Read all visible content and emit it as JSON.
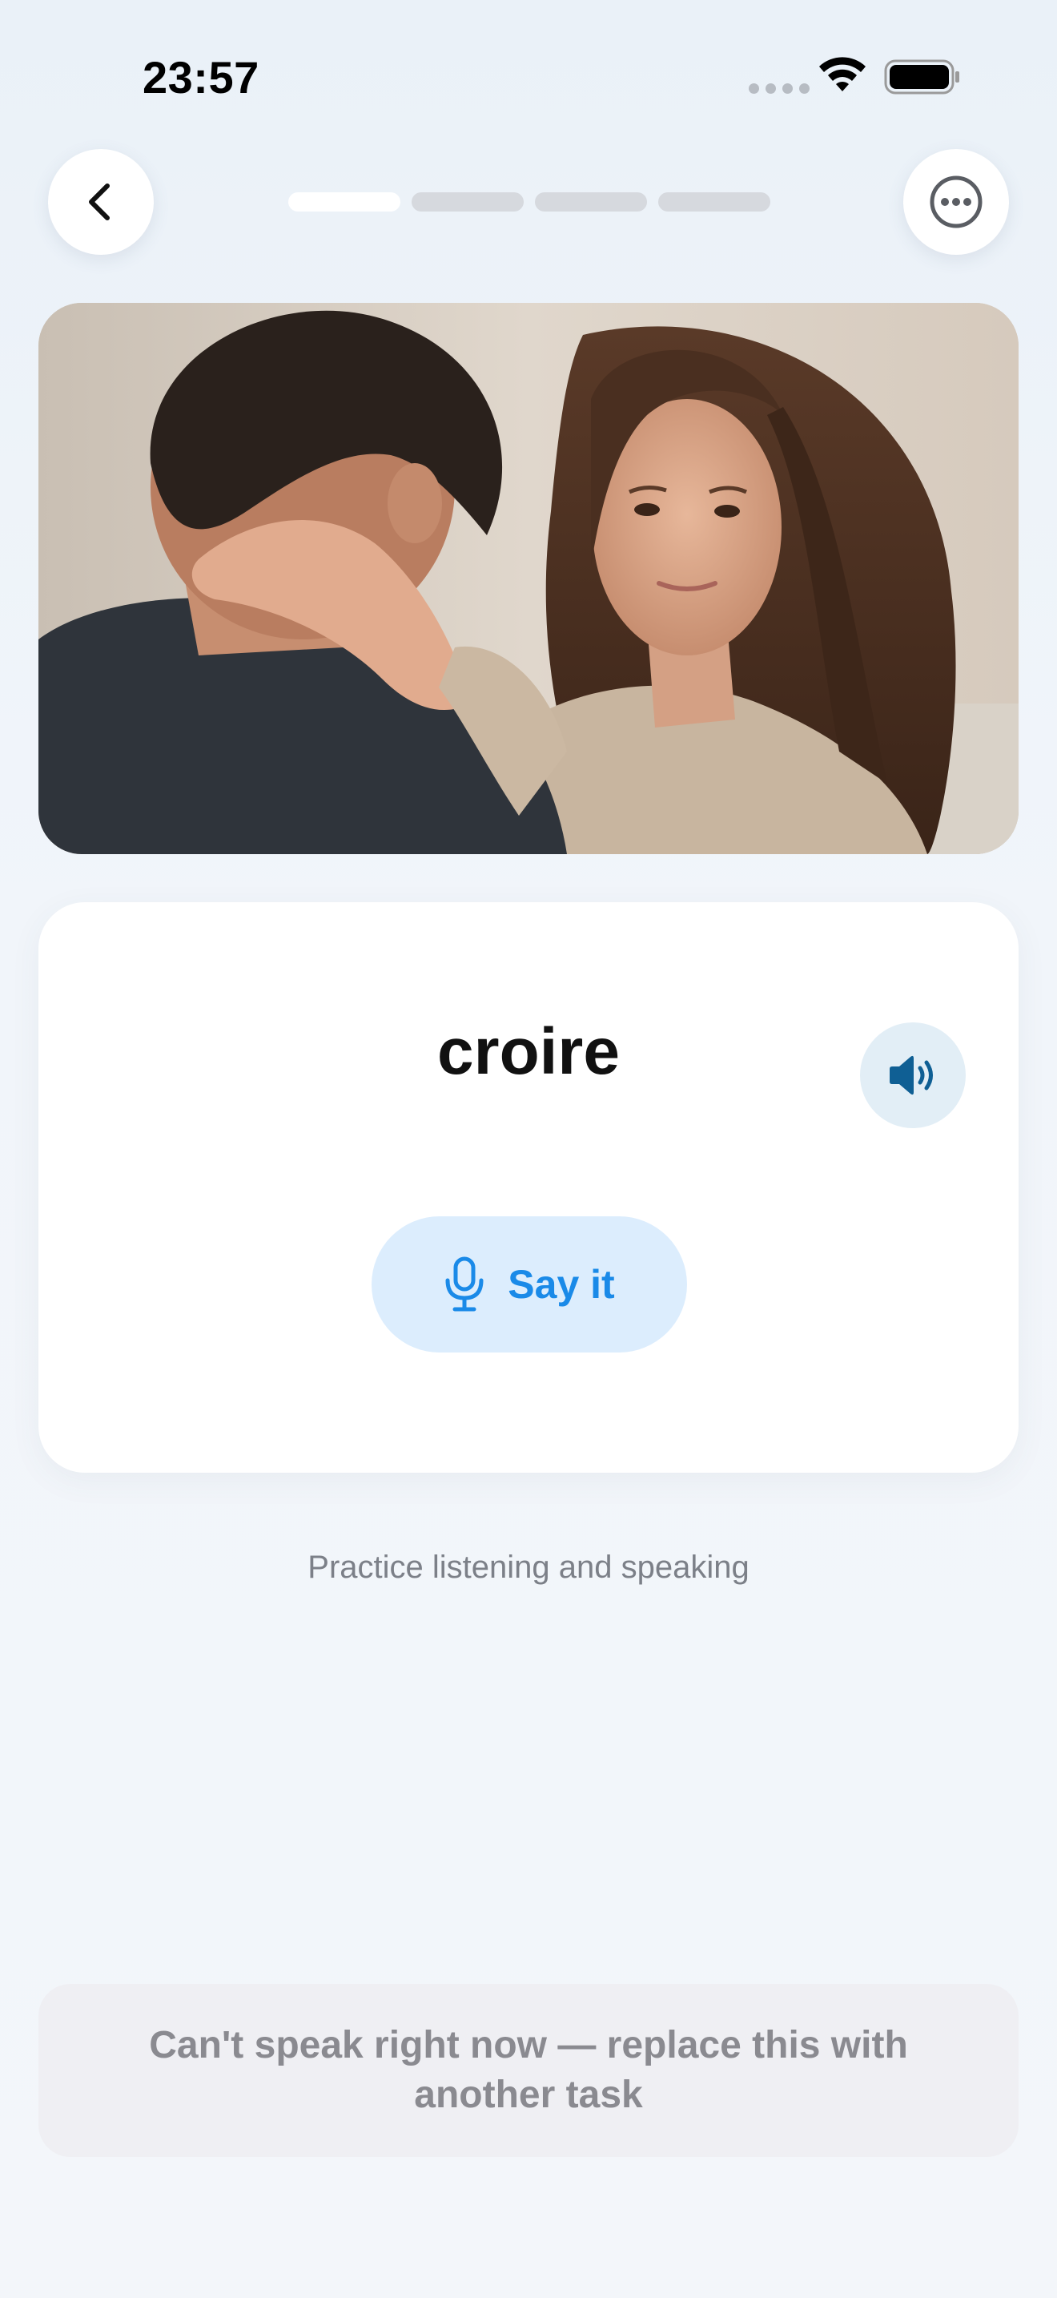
{
  "status_bar": {
    "time": "23:57"
  },
  "nav": {
    "back_icon": "chevron-left-icon",
    "more_icon": "ellipsis-circle-icon",
    "progress": {
      "total_steps": 4,
      "current_step": 1
    }
  },
  "hero_image": {
    "description_icon": "photo"
  },
  "word_card": {
    "word": "croire",
    "speaker_icon": "speaker-wave-icon",
    "say_button": {
      "icon": "microphone-icon",
      "label": "Say it"
    }
  },
  "hint": "Practice listening and speaking",
  "replace_task": {
    "label": "Can't speak right now — replace this with another task"
  },
  "colors": {
    "accent": "#1a8ae8",
    "speaker_icon": "#0f5f94",
    "background": "#eef3f9",
    "card": "#ffffff",
    "say_button_bg": "#dcedfd",
    "replace_bg": "#efeff3"
  }
}
